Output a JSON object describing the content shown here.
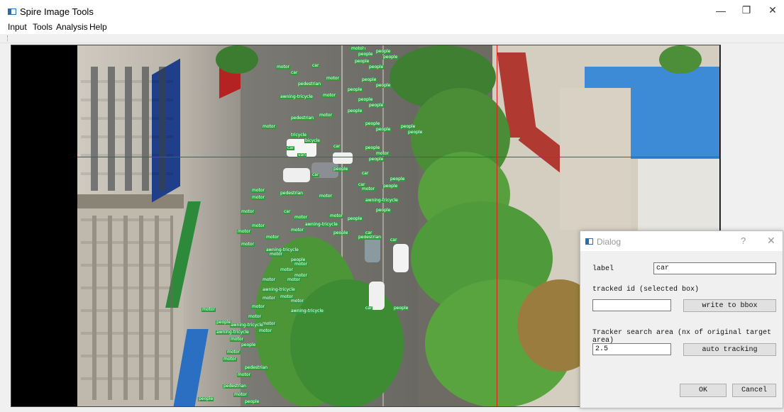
{
  "window": {
    "title": "Spire Image Tools",
    "minimize_glyph": "—",
    "restore_glyph": "❐",
    "close_glyph": "✕"
  },
  "menu": {
    "items": [
      "Input",
      "Tools",
      "Analysis",
      "Help"
    ]
  },
  "detections": [
    "people",
    "people",
    "people",
    "people",
    "people",
    "people",
    "motor",
    "car",
    "car",
    "motor",
    "pedestrian",
    "people",
    "people",
    "people",
    "awning-tricycle",
    "motor",
    "people",
    "people",
    "people",
    "pedestrian",
    "motor",
    "people",
    "people",
    "people",
    "people",
    "motor",
    "tricycle",
    "bicycle",
    "car",
    "car",
    "van",
    "people",
    "motor",
    "people",
    "people",
    "car",
    "car",
    "car",
    "people",
    "people",
    "motor",
    "pedestrian",
    "motor",
    "motor",
    "motor",
    "awning-tricycle",
    "people",
    "motor",
    "car",
    "motor",
    "awning-tricycle",
    "motor",
    "people",
    "motor",
    "motor",
    "motor",
    "motor",
    "people",
    "pedestrian",
    "motor",
    "awning-tricycle",
    "motor",
    "people",
    "motor",
    "motor",
    "motor",
    "car",
    "car",
    "motor",
    "motor",
    "awning-tricycle",
    "motor",
    "people",
    "car",
    "motor",
    "motor",
    "motor",
    "awning-tricycle",
    "motor",
    "motor",
    "awning-tricycle",
    "motor",
    "people",
    "motor",
    "awning-tricycle",
    "motor",
    "people",
    "motor",
    "motor",
    "pedestrian",
    "motor",
    "pedestrian",
    "motor",
    "people",
    "people",
    "motor"
  ],
  "dialog": {
    "title": "Dialog",
    "help": "?",
    "close": "✕",
    "label_caption": "label",
    "label_value": "car",
    "tracked_id_caption": "tracked id (selected box)",
    "tracked_id_value": "",
    "write_button": "write to bbox",
    "search_area_caption": "Tracker search area (nx of original target area)",
    "search_area_value": "2.5",
    "auto_tracking_button": "auto tracking",
    "ok_button": "OK",
    "cancel_button": "Cancel"
  },
  "colors": {
    "detection_label": "#2d9b3d",
    "crosshair": "#e11c1c",
    "app_icon": "#2e6ca8"
  }
}
